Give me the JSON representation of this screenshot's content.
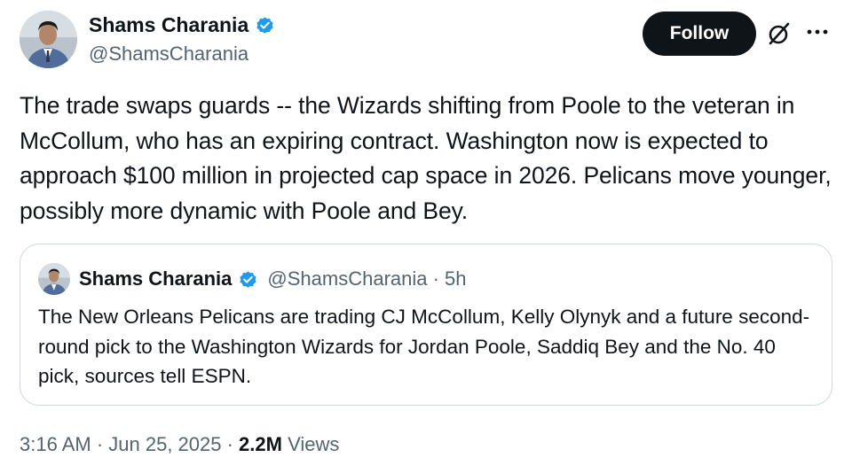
{
  "author": {
    "name": "Shams Charania",
    "handle": "@ShamsCharania",
    "verified_color": "#1d9bf0"
  },
  "actions": {
    "follow_label": "Follow",
    "grok_icon": "grok-icon",
    "more_icon": "more-icon",
    "more_label": "···"
  },
  "tweet": {
    "text": "The trade swaps guards -- the Wizards shifting from Poole to the veteran in McCollum, who has an expiring contract. Washington now is expected to approach $100 million in projected cap space in 2026. Pelicans move younger, possibly more dynamic with Poole and Bey."
  },
  "quoted": {
    "name": "Shams Charania",
    "meta": "@ShamsCharania · 5h",
    "text": "The New Orleans Pelicans are trading CJ McCollum, Kelly Olynyk and a future second-round pick to the Washington Wizards for Jordan Poole, Saddiq Bey and the No. 40 pick, sources tell ESPN."
  },
  "footer": {
    "timestamp": "3:16 AM · Jun 25, 2025 · ",
    "views_count": "2.2M",
    "views_label": " Views"
  },
  "colors": {
    "text_primary": "#0f1419",
    "text_secondary": "#536471",
    "border": "#cfd9de",
    "follow_bg": "#0f1419"
  }
}
